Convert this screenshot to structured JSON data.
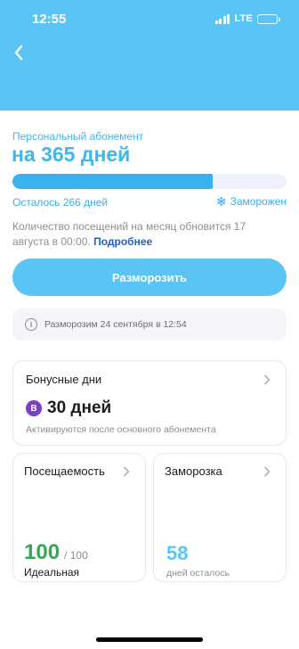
{
  "status_bar": {
    "time": "12:55",
    "network": "LTE",
    "signal_bars": 4,
    "battery_level": 0.25
  },
  "header": {
    "back_icon": "chevron-left-icon",
    "background_color": "#5ac5f5"
  },
  "subscription": {
    "label": "Персональный абонемент",
    "title": "на 365 дней",
    "progress_fraction": 0.73,
    "remaining": "Осталось 266 дней",
    "status": "Заморожен",
    "status_icon": "snowflake-icon",
    "note": "Количество посещений на месяц обновится 17 августа в 00:00.",
    "note_link": "Подробнее",
    "accent_color": "#40b6ef"
  },
  "unfreeze_button": {
    "label": "Разморозить"
  },
  "info": {
    "icon": "info-icon",
    "text": "Разморозим 24 сентября в 12:54"
  },
  "bonus_card": {
    "title": "Бонусные дни",
    "badge": "B",
    "badge_color": "#7b3fc6",
    "value": "30 дней",
    "subtitle": "Активируются после основного абонемента"
  },
  "attendance_card": {
    "title": "Посещаемость",
    "value": "100",
    "total": "/ 100",
    "status": "Идеальная",
    "value_color": "#32a852"
  },
  "freeze_card": {
    "title": "Заморозка",
    "value": "58",
    "subtitle": "дней осталось",
    "value_color": "#5ac5f5"
  }
}
